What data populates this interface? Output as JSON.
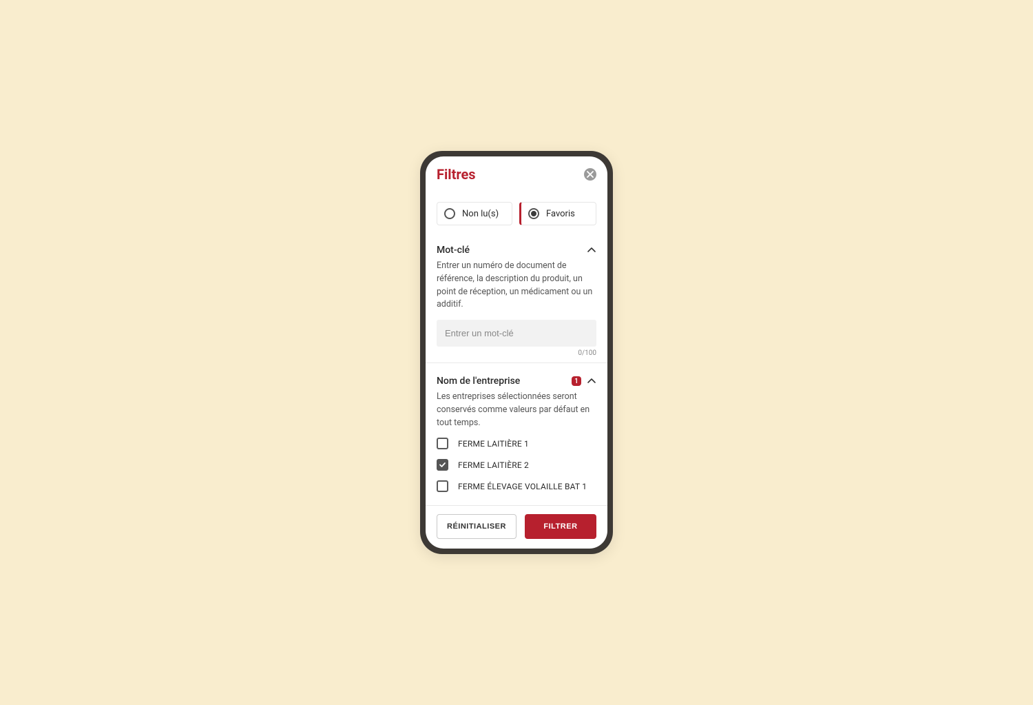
{
  "header": {
    "title": "Filtres"
  },
  "toggles": {
    "unread": {
      "label": "Non lu(s)",
      "selected": false
    },
    "favorites": {
      "label": "Favoris",
      "selected": true
    }
  },
  "keyword": {
    "title": "Mot-clé",
    "description": "Entrer un numéro de document de référence, la description du produit, un point de réception, un médicament ou un additif.",
    "placeholder": "Entrer un mot-clé",
    "value": "",
    "char_count": "0/100"
  },
  "company": {
    "title": "Nom de l'entreprise",
    "badge": "1",
    "description": "Les entreprises sélectionnées seront conservés comme valeurs par défaut en tout temps.",
    "items": [
      {
        "label": "FERME LAITIÈRE 1",
        "checked": false
      },
      {
        "label": "FERME LAITIÈRE 2",
        "checked": true
      },
      {
        "label": "FERME ÉLEVAGE VOLAILLE BAT 1",
        "checked": false
      }
    ]
  },
  "footer": {
    "reset": "RÉINITIALISER",
    "filter": "FILTRER"
  },
  "colors": {
    "accent": "#b7202e",
    "background": "#f9edce"
  }
}
